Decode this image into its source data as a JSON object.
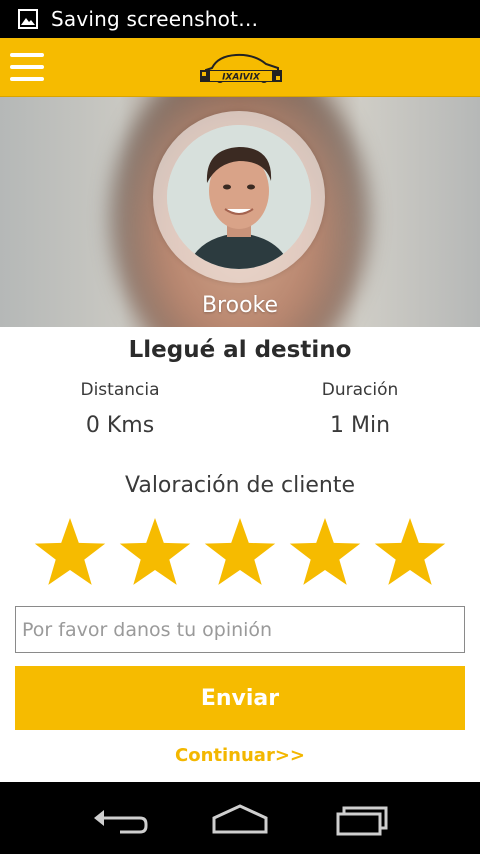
{
  "status_bar": {
    "notification_icon": "image-icon",
    "text": "Saving screenshot…"
  },
  "app_bar": {
    "menu_icon": "hamburger-menu-icon",
    "logo": "taxi-car-logo",
    "logo_text": "IXAIVIX",
    "color": "#f6bb00"
  },
  "profile": {
    "driver_name": "Brooke"
  },
  "trip": {
    "title": "Llegué al destino",
    "distance_label": "Distancia",
    "distance_value": "0 Kms",
    "duration_label": "Duración",
    "duration_value": "1 Min"
  },
  "rating": {
    "title": "Valoración de cliente",
    "stars_filled": 5,
    "stars_total": 5,
    "star_color": "#f6bb00"
  },
  "feedback": {
    "value": "",
    "placeholder": "Por favor danos tu opinión"
  },
  "actions": {
    "send_label": "Enviar",
    "continue_label": "Continuar>>"
  },
  "nav_bar": {
    "back_icon": "back-icon",
    "home_icon": "home-icon",
    "recents_icon": "recent-apps-icon"
  }
}
